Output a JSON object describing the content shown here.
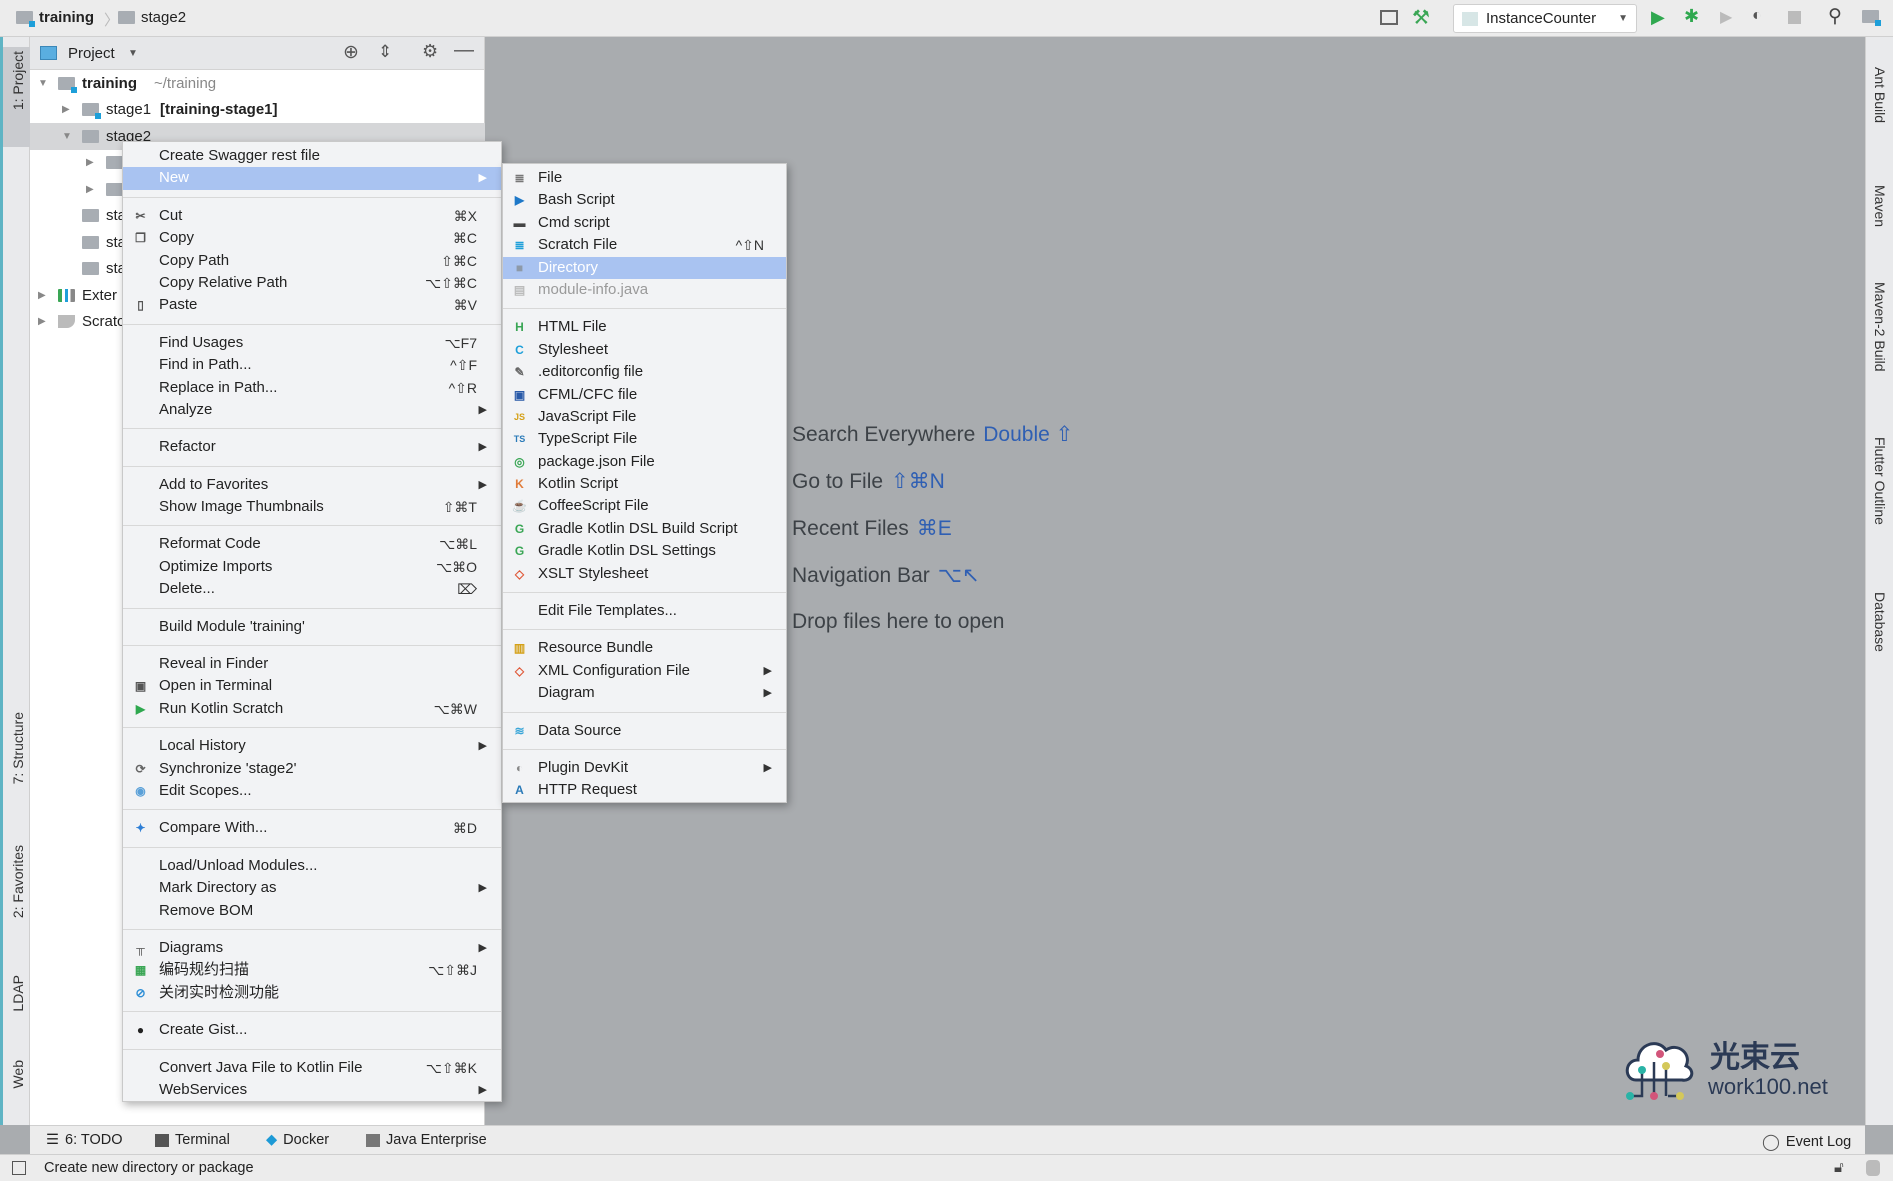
{
  "breadcrumb": [
    "training",
    "stage2"
  ],
  "toolbar": {
    "run_config": "InstanceCounter"
  },
  "project_panel": {
    "title": "Project",
    "tree": [
      {
        "label": "training",
        "suffix": "~/training",
        "bold": true,
        "level": 0,
        "expanded": true,
        "module": true
      },
      {
        "label": "stage1",
        "suffix": "[training-stage1]",
        "level": 1,
        "expanded": false,
        "module": true
      },
      {
        "label": "stage2",
        "level": 1,
        "expanded": true,
        "selected": true
      },
      {
        "label": "",
        "level": 2,
        "expanded": false
      },
      {
        "label": "",
        "level": 2,
        "expanded": false
      },
      {
        "label": "sta",
        "level": 1
      },
      {
        "label": "sta",
        "level": 1
      },
      {
        "label": "sta",
        "level": 1
      },
      {
        "label": "Exter",
        "level": 0,
        "expanded": false,
        "icon": "libraries-icon"
      },
      {
        "label": "Scratc",
        "level": 0,
        "expanded": false,
        "icon": "scratches-icon"
      }
    ]
  },
  "left_tools": [
    {
      "label": "1: Project"
    },
    {
      "label": "7: Structure"
    },
    {
      "label": "2: Favorites"
    },
    {
      "label": "LDAP"
    },
    {
      "label": "Web"
    }
  ],
  "right_tools": [
    {
      "label": "Ant Build"
    },
    {
      "label": "Maven"
    },
    {
      "label": "Maven-2 Build"
    },
    {
      "label": "Flutter Outline"
    },
    {
      "label": "Database"
    }
  ],
  "context_menu": [
    [
      {
        "label": "Create Swagger rest file"
      },
      {
        "label": "New",
        "arrow": true,
        "highlighted": true
      }
    ],
    [
      {
        "label": "Cut",
        "shortcut": "⌘X",
        "icon": "scissors-icon"
      },
      {
        "label": "Copy",
        "shortcut": "⌘C",
        "icon": "copy-icon"
      },
      {
        "label": "Copy Path",
        "shortcut": "⇧⌘C"
      },
      {
        "label": "Copy Relative Path",
        "shortcut": "⌥⇧⌘C"
      },
      {
        "label": "Paste",
        "shortcut": "⌘V",
        "icon": "paste-icon"
      }
    ],
    [
      {
        "label": "Find Usages",
        "shortcut": "⌥F7"
      },
      {
        "label": "Find in Path...",
        "shortcut": "^⇧F"
      },
      {
        "label": "Replace in Path...",
        "shortcut": "^⇧R"
      },
      {
        "label": "Analyze",
        "arrow": true
      }
    ],
    [
      {
        "label": "Refactor",
        "arrow": true
      }
    ],
    [
      {
        "label": "Add to Favorites",
        "arrow": true
      },
      {
        "label": "Show Image Thumbnails",
        "shortcut": "⇧⌘T"
      }
    ],
    [
      {
        "label": "Reformat Code",
        "shortcut": "⌥⌘L"
      },
      {
        "label": "Optimize Imports",
        "shortcut": "⌥⌘O"
      },
      {
        "label": "Delete...",
        "shortcut": "⌦"
      }
    ],
    [
      {
        "label": "Build Module 'training'"
      }
    ],
    [
      {
        "label": "Reveal in Finder"
      },
      {
        "label": "Open in Terminal",
        "icon": "terminal-icon"
      },
      {
        "label": "Run Kotlin Scratch",
        "shortcut": "⌥⌘W",
        "icon": "run-icon"
      }
    ],
    [
      {
        "label": "Local History",
        "arrow": true
      },
      {
        "label": "Synchronize 'stage2'",
        "icon": "sync-icon"
      },
      {
        "label": "Edit Scopes...",
        "icon": "scope-icon"
      }
    ],
    [
      {
        "label": "Compare With...",
        "shortcut": "⌘D",
        "icon": "compare-icon"
      }
    ],
    [
      {
        "label": "Load/Unload Modules..."
      },
      {
        "label": "Mark Directory as",
        "arrow": true
      },
      {
        "label": "Remove BOM"
      }
    ],
    [
      {
        "label": "Diagrams",
        "arrow": true,
        "icon": "diagram-icon"
      },
      {
        "label": "编码规约扫描",
        "shortcut": "⌥⇧⌘J",
        "icon": "scan-icon"
      },
      {
        "label": "关闭实时检测功能",
        "icon": "disable-icon"
      }
    ],
    [
      {
        "label": "Create Gist...",
        "icon": "github-icon"
      }
    ],
    [
      {
        "label": "Convert Java File to Kotlin File",
        "shortcut": "⌥⇧⌘K"
      },
      {
        "label": "WebServices",
        "arrow": true
      }
    ]
  ],
  "new_submenu": [
    [
      {
        "label": "File",
        "icon": "file-icon"
      },
      {
        "label": "Bash Script",
        "icon": "bash-icon"
      },
      {
        "label": "Cmd script",
        "icon": "cmd-icon"
      },
      {
        "label": "Scratch File",
        "shortcut": "^⇧N",
        "icon": "scratch-icon"
      },
      {
        "label": "Directory",
        "highlighted": true,
        "icon": "folder-icon"
      },
      {
        "label": "module-info.java",
        "disabled": true,
        "icon": "java-file-icon"
      }
    ],
    [
      {
        "label": "HTML File",
        "icon": "html-icon"
      },
      {
        "label": "Stylesheet",
        "icon": "css-icon"
      },
      {
        "label": ".editorconfig file",
        "icon": "editorconfig-icon"
      },
      {
        "label": "CFML/CFC file",
        "icon": "cfml-icon"
      },
      {
        "label": "JavaScript File",
        "icon": "js-icon"
      },
      {
        "label": "TypeScript File",
        "icon": "ts-icon"
      },
      {
        "label": "package.json File",
        "icon": "npm-icon"
      },
      {
        "label": "Kotlin Script",
        "icon": "kotlin-icon"
      },
      {
        "label": "CoffeeScript File",
        "icon": "coffee-icon"
      },
      {
        "label": "Gradle Kotlin DSL Build Script",
        "icon": "gradle-icon"
      },
      {
        "label": "Gradle Kotlin DSL Settings",
        "icon": "gradle-icon"
      },
      {
        "label": "XSLT Stylesheet",
        "icon": "xslt-icon"
      }
    ],
    [
      {
        "label": "Edit File Templates..."
      }
    ],
    [
      {
        "label": "Resource Bundle",
        "icon": "bundle-icon"
      },
      {
        "label": "XML Configuration File",
        "arrow": true,
        "icon": "xml-icon"
      },
      {
        "label": "Diagram",
        "arrow": true
      }
    ],
    [
      {
        "label": "Data Source",
        "icon": "database-icon"
      }
    ],
    [
      {
        "label": "Plugin DevKit",
        "arrow": true,
        "icon": "plugin-icon"
      },
      {
        "label": "HTTP Request",
        "icon": "api-icon"
      }
    ]
  ],
  "welcome": [
    {
      "text": "Search Everywhere",
      "key": "Double ⇧"
    },
    {
      "text": "Go to File",
      "key": "⇧⌘N"
    },
    {
      "text": "Recent Files",
      "key": "⌘E"
    },
    {
      "text": "Navigation Bar",
      "key": "⌥↖"
    },
    {
      "text": "Drop files here to open",
      "key": ""
    }
  ],
  "bottom_tools": [
    {
      "label": "6: TODO"
    },
    {
      "label": "Terminal"
    },
    {
      "label": "Docker"
    },
    {
      "label": "Java Enterprise"
    }
  ],
  "event_log": "Event Log",
  "status": "Create new directory or package",
  "watermark": {
    "cn": "光束云",
    "en": "work100.net"
  },
  "colors": {
    "highlight": "#a9c3f1",
    "accent_green": "#3aa655",
    "link": "#2f5fb3"
  }
}
